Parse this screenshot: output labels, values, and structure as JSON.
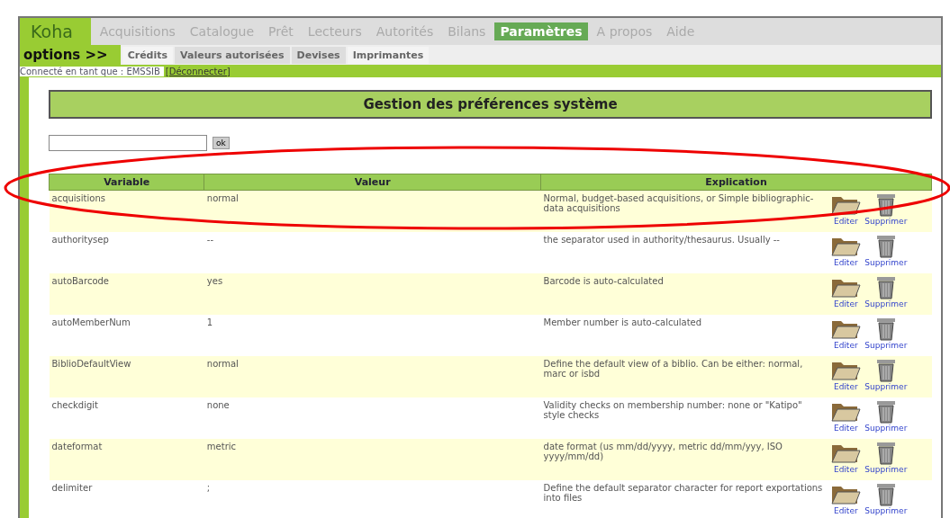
{
  "nav": {
    "logo": "Koha",
    "tabs": [
      {
        "label": "Acquisitions",
        "selected": false
      },
      {
        "label": "Catalogue",
        "selected": false
      },
      {
        "label": "Prêt",
        "selected": false
      },
      {
        "label": "Lecteurs",
        "selected": false
      },
      {
        "label": "Autorités",
        "selected": false
      },
      {
        "label": "Bilans",
        "selected": false
      },
      {
        "label": "Paramètres",
        "selected": true
      },
      {
        "label": "A propos",
        "selected": false
      },
      {
        "label": "Aide",
        "selected": false
      }
    ]
  },
  "subnav": {
    "title": "options >>",
    "tabs": [
      {
        "label": "Crédits",
        "selected": true
      },
      {
        "label": "Valeurs autorisées",
        "selected": false
      },
      {
        "label": "Devises",
        "selected": false
      },
      {
        "label": "Imprimantes",
        "selected": true
      }
    ]
  },
  "login": {
    "text": "Connecté en tant que : EMSSIB",
    "logout": "[Déconnecter]"
  },
  "title": "Gestion des préférences système",
  "search": {
    "button": "ok"
  },
  "table": {
    "columns": [
      "Variable",
      "Valeur",
      "Explication"
    ],
    "rows": [
      {
        "variable": "acquisitions",
        "value": "normal",
        "explanation": "Normal, budget-based acquisitions, or Simple bibliographic-data acquisitions",
        "edit": "Editer",
        "delete": "Supprimer"
      },
      {
        "variable": "authoritysep",
        "value": "--",
        "explanation": "the separator used in authority/thesaurus. Usually --",
        "edit": "Editer",
        "delete": "Supprimer"
      },
      {
        "variable": "autoBarcode",
        "value": "yes",
        "explanation": "Barcode is auto-calculated",
        "edit": "Editer",
        "delete": "Supprimer"
      },
      {
        "variable": "autoMemberNum",
        "value": "1",
        "explanation": "Member number is auto-calculated",
        "edit": "Editer",
        "delete": "Supprimer"
      },
      {
        "variable": "BiblioDefaultView",
        "value": "normal",
        "explanation": "Define the default view of a biblio. Can be either: normal, marc or isbd",
        "edit": "Editer",
        "delete": "Supprimer"
      },
      {
        "variable": "checkdigit",
        "value": "none",
        "explanation": "Validity checks on membership number: none or \"Katipo\" style checks",
        "edit": "Editer",
        "delete": "Supprimer"
      },
      {
        "variable": "dateformat",
        "value": "metric",
        "explanation": "date format (us mm/dd/yyyy, metric dd/mm/yyy, ISO yyyy/mm/dd)",
        "edit": "Editer",
        "delete": "Supprimer"
      },
      {
        "variable": "delimiter",
        "value": ";",
        "explanation": "Define the default separator character for report exportations into files",
        "edit": "Editer",
        "delete": "Supprimer"
      }
    ]
  }
}
